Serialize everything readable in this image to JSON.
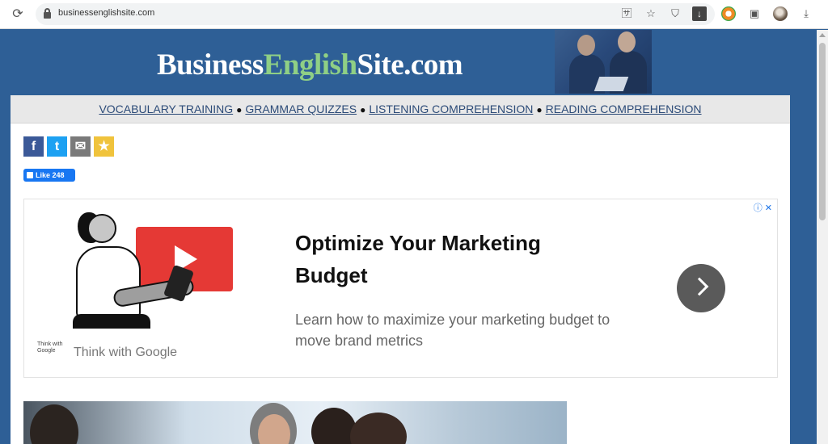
{
  "browser": {
    "url": "businessenglishsite.com"
  },
  "site": {
    "logo_part1": "Business",
    "logo_part2": "English",
    "logo_part3": "Site.com"
  },
  "nav": {
    "items": [
      "VOCABULARY TRAINING",
      "GRAMMAR QUIZZES",
      "LISTENING COMPREHENSION",
      "READING COMPREHENSION"
    ],
    "separator": "●"
  },
  "social": {
    "like_label": "Like 248"
  },
  "ad": {
    "title": "Optimize Your Marketing Budget",
    "description": "Learn how to maximize your marketing budget to move brand metrics",
    "brand": "Think with Google",
    "brand_logo_text": "Think with Google",
    "choices_label": "ⓘ ✕"
  },
  "colors": {
    "page_background": "#2e5f96",
    "logo_accent": "#8fcf85",
    "nav_link": "#2c4b78",
    "ad_play_red": "#e53935"
  },
  "icons": {
    "omnibox": [
      "translate-icon",
      "star-icon",
      "shield-icon",
      "download-icon"
    ],
    "toolbar": [
      "extension-icon",
      "puzzle-icon",
      "profile-avatar",
      "downloads-icon"
    ]
  }
}
